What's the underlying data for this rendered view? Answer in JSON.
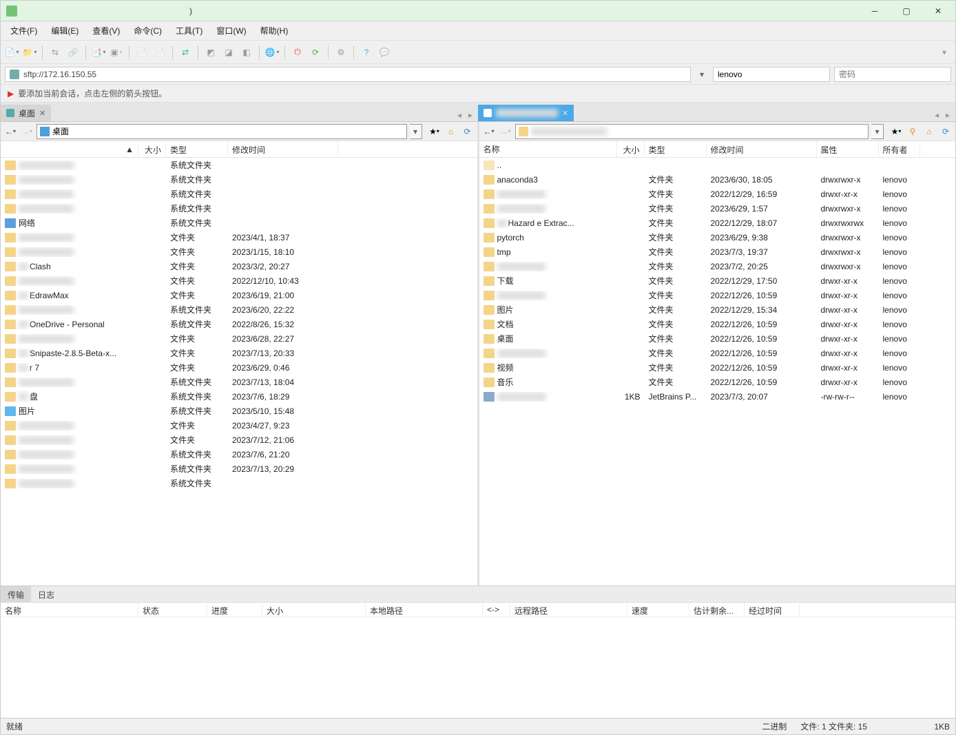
{
  "window": {
    "title": ")"
  },
  "menu": [
    "文件(F)",
    "编辑(E)",
    "查看(V)",
    "命令(C)",
    "工具(T)",
    "窗口(W)",
    "帮助(H)"
  ],
  "conn": {
    "address": "sftp://172.16.150.55",
    "user": "lenovo",
    "pass_placeholder": "密码"
  },
  "hint": "要添加当前会话，点击左侧的箭头按钮。",
  "tabs": {
    "local_label": "桌面",
    "remote_label": " "
  },
  "local": {
    "path": "桌面",
    "cols": {
      "name": "",
      "size": "大小",
      "type": "类型",
      "mod": "修改时间"
    },
    "rows": [
      {
        "name": "",
        "type": "系统文件夹",
        "mod": "",
        "blur": true
      },
      {
        "name": "",
        "type": "系统文件夹",
        "mod": "",
        "blur": true
      },
      {
        "name": "",
        "type": "系统文件夹",
        "mod": "",
        "blur": true
      },
      {
        "name": "",
        "type": "系统文件夹",
        "mod": "",
        "blur": true
      },
      {
        "name": "网络",
        "type": "系统文件夹",
        "mod": "",
        "icon": "blue"
      },
      {
        "name": "",
        "type": "文件夹",
        "mod": "2023/4/1, 18:37",
        "blur": true
      },
      {
        "name": "",
        "type": "文件夹",
        "mod": "2023/1/15, 18:10",
        "blur": true
      },
      {
        "name": "Clash",
        "type": "文件夹",
        "mod": "2023/3/2, 20:27",
        "halfblur": true
      },
      {
        "name": "",
        "type": "文件夹",
        "mod": "2022/12/10, 10:43",
        "blur": true
      },
      {
        "name": "EdrawMax",
        "type": "文件夹",
        "mod": "2023/6/19, 21:00",
        "halfblur": true
      },
      {
        "name": "",
        "type": "系统文件夹",
        "mod": "2023/6/20, 22:22",
        "blur": true
      },
      {
        "name": "OneDrive - Personal",
        "type": "系统文件夹",
        "mod": "2022/8/26, 15:32",
        "halfblur": true
      },
      {
        "name": "",
        "type": "文件夹",
        "mod": "2023/6/28, 22:27",
        "blur": true
      },
      {
        "name": "Snipaste-2.8.5-Beta-x...",
        "type": "文件夹",
        "mod": "2023/7/13, 20:33",
        "halfblur": true
      },
      {
        "name": "r 7",
        "type": "文件夹",
        "mod": "2023/6/29, 0:46",
        "halfblur": true
      },
      {
        "name": "",
        "type": "系统文件夹",
        "mod": "2023/7/13, 18:04",
        "blur": true
      },
      {
        "name": "盘",
        "type": "系统文件夹",
        "mod": "2023/7/6, 18:29",
        "halfblur": true
      },
      {
        "name": "图片",
        "type": "系统文件夹",
        "mod": "2023/5/10, 15:48",
        "icon": "img"
      },
      {
        "name": "",
        "type": "文件夹",
        "mod": "2023/4/27, 9:23",
        "blur": true
      },
      {
        "name": "",
        "type": "文件夹",
        "mod": "2023/7/12, 21:06",
        "blur": true
      },
      {
        "name": "",
        "type": "系统文件夹",
        "mod": "2023/7/6, 21:20",
        "blur": true
      },
      {
        "name": "",
        "type": "系统文件夹",
        "mod": "2023/7/13, 20:29",
        "blur": true
      },
      {
        "name": "",
        "type": "系统文件夹",
        "mod": "",
        "blur": true
      }
    ]
  },
  "remote": {
    "path": " ",
    "cols": {
      "name": "名称",
      "size": "大小",
      "type": "类型",
      "mod": "修改时间",
      "attr": "属性",
      "own": "所有者"
    },
    "rows": [
      {
        "name": "..",
        "type": "",
        "mod": "",
        "attr": "",
        "own": "",
        "up": true
      },
      {
        "name": "anaconda3",
        "type": "文件夹",
        "mod": "2023/6/30, 18:05",
        "attr": "drwxrwxr-x",
        "own": "lenovo"
      },
      {
        "name": "",
        "type": "文件夹",
        "mod": "2022/12/29, 16:59",
        "attr": "drwxr-xr-x",
        "own": "lenovo",
        "blur": true
      },
      {
        "name": "",
        "type": "文件夹",
        "mod": "2023/6/29, 1:57",
        "attr": "drwxrwxr-x",
        "own": "lenovo",
        "blur": true
      },
      {
        "name": "Hazard    e Extrac...",
        "type": "文件夹",
        "mod": "2022/12/29, 18:07",
        "attr": "drwxrwxrwx",
        "own": "lenovo",
        "halfblur": true
      },
      {
        "name": "pytorch",
        "type": "文件夹",
        "mod": "2023/6/29, 9:38",
        "attr": "drwxrwxr-x",
        "own": "lenovo"
      },
      {
        "name": "tmp",
        "type": "文件夹",
        "mod": "2023/7/3, 19:37",
        "attr": "drwxrwxr-x",
        "own": "lenovo"
      },
      {
        "name": "",
        "type": "文件夹",
        "mod": "2023/7/2, 20:25",
        "attr": "drwxrwxr-x",
        "own": "lenovo",
        "blur": true
      },
      {
        "name": "下载",
        "type": "文件夹",
        "mod": "2022/12/29, 17:50",
        "attr": "drwxr-xr-x",
        "own": "lenovo"
      },
      {
        "name": "",
        "type": "文件夹",
        "mod": "2022/12/26, 10:59",
        "attr": "drwxr-xr-x",
        "own": "lenovo",
        "blur": true
      },
      {
        "name": "图片",
        "type": "文件夹",
        "mod": "2022/12/29, 15:34",
        "attr": "drwxr-xr-x",
        "own": "lenovo"
      },
      {
        "name": "文档",
        "type": "文件夹",
        "mod": "2022/12/26, 10:59",
        "attr": "drwxr-xr-x",
        "own": "lenovo"
      },
      {
        "name": "桌面",
        "type": "文件夹",
        "mod": "2022/12/26, 10:59",
        "attr": "drwxr-xr-x",
        "own": "lenovo"
      },
      {
        "name": "",
        "type": "文件夹",
        "mod": "2022/12/26, 10:59",
        "attr": "drwxr-xr-x",
        "own": "lenovo",
        "blur": true
      },
      {
        "name": "视频",
        "type": "文件夹",
        "mod": "2022/12/26, 10:59",
        "attr": "drwxr-xr-x",
        "own": "lenovo"
      },
      {
        "name": "音乐",
        "type": "文件夹",
        "mod": "2022/12/26, 10:59",
        "attr": "drwxr-xr-x",
        "own": "lenovo"
      },
      {
        "name": "",
        "size": "1KB",
        "type": "JetBrains P...",
        "mod": "2023/7/3, 20:07",
        "attr": "-rw-rw-r--",
        "own": "lenovo",
        "icon": "file",
        "blur": true
      }
    ]
  },
  "bottom_tabs": {
    "transfer": "传输",
    "log": "日志"
  },
  "transfer_cols": [
    "名称",
    "状态",
    "进度",
    "大小",
    "本地路径",
    "<->",
    "远程路径",
    "速度",
    "估计剩余...",
    "经过时间"
  ],
  "status": {
    "ready": "就绪",
    "mode": "二进制",
    "counts": "文件: 1  文件夹: 15",
    "size": "1KB"
  }
}
